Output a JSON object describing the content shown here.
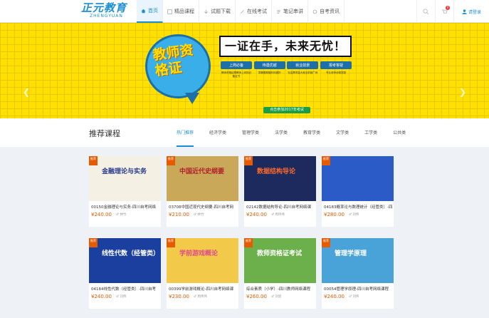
{
  "header": {
    "logo_main": "正元教育",
    "logo_sub": "ZHENGYUAN",
    "nav": [
      {
        "label": "首页",
        "active": true
      },
      {
        "label": "精品课程",
        "active": false
      },
      {
        "label": "试题下载",
        "active": false
      },
      {
        "label": "在线考试",
        "active": false
      },
      {
        "label": "笔记串讲",
        "active": false
      },
      {
        "label": "自考资讯",
        "active": false
      }
    ],
    "cart_badge": "0",
    "login_label": "请登录"
  },
  "banner": {
    "bubble_text": "教师资格证",
    "slogan": "一证在手，未来无忧！",
    "features": [
      {
        "title": "上岗必备",
        "desc": "教师资格证是教师上岗的必备证书"
      },
      {
        "title": "待遇优越",
        "desc": "寒暑假期福利待遇好"
      },
      {
        "title": "就业前景",
        "desc": "社会需求量大就业前景广阔"
      },
      {
        "title": "报考答疑",
        "desc": "专业老师全程答疑"
      }
    ],
    "cta": "点击参加2017年考试",
    "dots": 5,
    "active_dot": 1
  },
  "recommend": {
    "title": "推荐课程",
    "tabs": [
      "热门推荐",
      "经济学类",
      "管理学类",
      "法学类",
      "教育学类",
      "文学类",
      "工学类",
      "公共类"
    ],
    "active_tab": 0,
    "tag_label": "推荐",
    "courses": [
      {
        "title": "00150金融理论与实务-四川自考网络",
        "price": "¥240.00",
        "teacher": "林竹",
        "thumb_text": "金融理论与实务",
        "bg": "#f4f1e4",
        "fg": "#2a3a8a"
      },
      {
        "title": "03708中国近现代史纲要-四川自考网",
        "price": "¥210.00",
        "teacher": "林竹",
        "thumb_text": "中国近代史纲要",
        "bg": "#c9a85a",
        "fg": "#b0202a"
      },
      {
        "title": "02142数据结构导论-四川自考网络课",
        "price": "¥240.00",
        "teacher": "周玮伟",
        "thumb_text": "数据结构导论",
        "bg": "#1c2a5e",
        "fg": "#ff6a2a"
      },
      {
        "title": "04183概率论与数理统计（经管类）-四",
        "price": "¥280.00",
        "teacher": "刘伟",
        "thumb_text": "",
        "bg": "#2a5bc7",
        "fg": "#ffffff"
      },
      {
        "title": "04184线性代数（经管类）-四川自考",
        "price": "¥240.00",
        "teacher": "刘伟",
        "thumb_text": "线性代数（经管类）",
        "bg": "#1a3f9e",
        "fg": "#ffffff"
      },
      {
        "title": "00399学前游戏概论-四川自考网络课",
        "price": "¥230.00",
        "teacher": "周伟伟",
        "thumb_text": "学前游戏概论",
        "bg": "#f3c94a",
        "fg": "#e14a8a"
      },
      {
        "title": "综合素质（小学）-四川教师网络课程",
        "price": "¥260.00",
        "teacher": "刘思",
        "thumb_text": "教师资格证考试",
        "bg": "#6bb04a",
        "fg": "#ffffff"
      },
      {
        "title": "00054管理学原理-四川自考网络课程",
        "price": "¥240.00",
        "teacher": "刘伟",
        "thumb_text": "管理学原理",
        "bg": "#4aa3d8",
        "fg": "#ffffff"
      }
    ]
  }
}
